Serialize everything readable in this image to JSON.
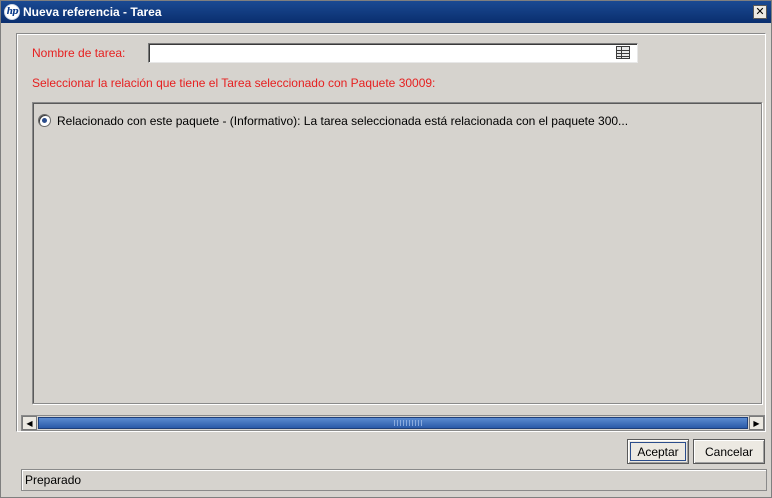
{
  "window": {
    "title": "Nueva referencia - Tarea",
    "close_glyph": "✕"
  },
  "form": {
    "name_label": "Nombre de tarea:",
    "name_value": "",
    "instruction": "Seleccionar la relación que tiene el Tarea seleccionado con Paquete 30009:",
    "options": [
      {
        "label": "Relacionado con este paquete - (Informativo): La tarea seleccionada está relacionada con el paquete 300...",
        "selected": true
      }
    ]
  },
  "buttons": {
    "accept": "Aceptar",
    "cancel": "Cancelar"
  },
  "status": {
    "text": "Preparado"
  },
  "colors": {
    "title_bar": "#1a4a93",
    "required_label": "#e62020",
    "scroll_thumb": "#2a5aa8"
  },
  "icons": {
    "app": "hp-logo-icon",
    "lookup": "table-lookup-icon",
    "close": "close-icon"
  }
}
